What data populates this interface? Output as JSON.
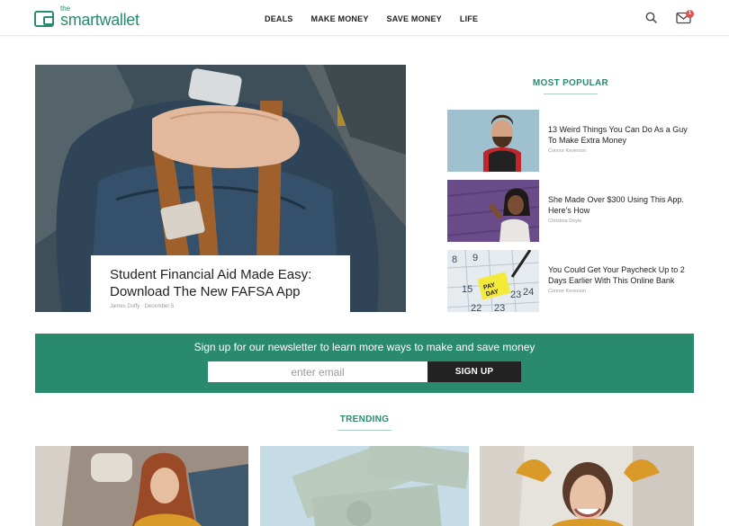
{
  "logo": {
    "the": "the",
    "name": "smartwallet"
  },
  "nav": {
    "items": [
      "DEALS",
      "MAKE MONEY",
      "SAVE MONEY",
      "LIFE"
    ]
  },
  "header": {
    "badge_count": "1",
    "icons": [
      "search-icon",
      "mail-icon"
    ]
  },
  "hero": {
    "title": "Student Financial Aid Made Easy: Download The New FAFSA App",
    "author": "James Duffy",
    "date": "December 5"
  },
  "most_popular": {
    "heading": "MOST POPULAR",
    "items": [
      {
        "title": "13 Weird Things You Can Do As a Guy To Make Extra Money",
        "author": "Connor Kevinson"
      },
      {
        "title": "She Made Over $300 Using This App. Here's How",
        "author": "Christina Doyle"
      },
      {
        "title": "You Could Get Your Paycheck Up to 2 Days Earlier With This Online Bank",
        "author": "Connor Kevinson"
      }
    ]
  },
  "newsletter": {
    "text": "Sign up for our newsletter to learn more ways to make and save money",
    "placeholder": "enter email",
    "button": "SIGN UP"
  },
  "trending": {
    "heading": "TRENDING"
  },
  "colors": {
    "brand": "#2a8a6e",
    "button": "#222222",
    "badge": "#e05050"
  }
}
